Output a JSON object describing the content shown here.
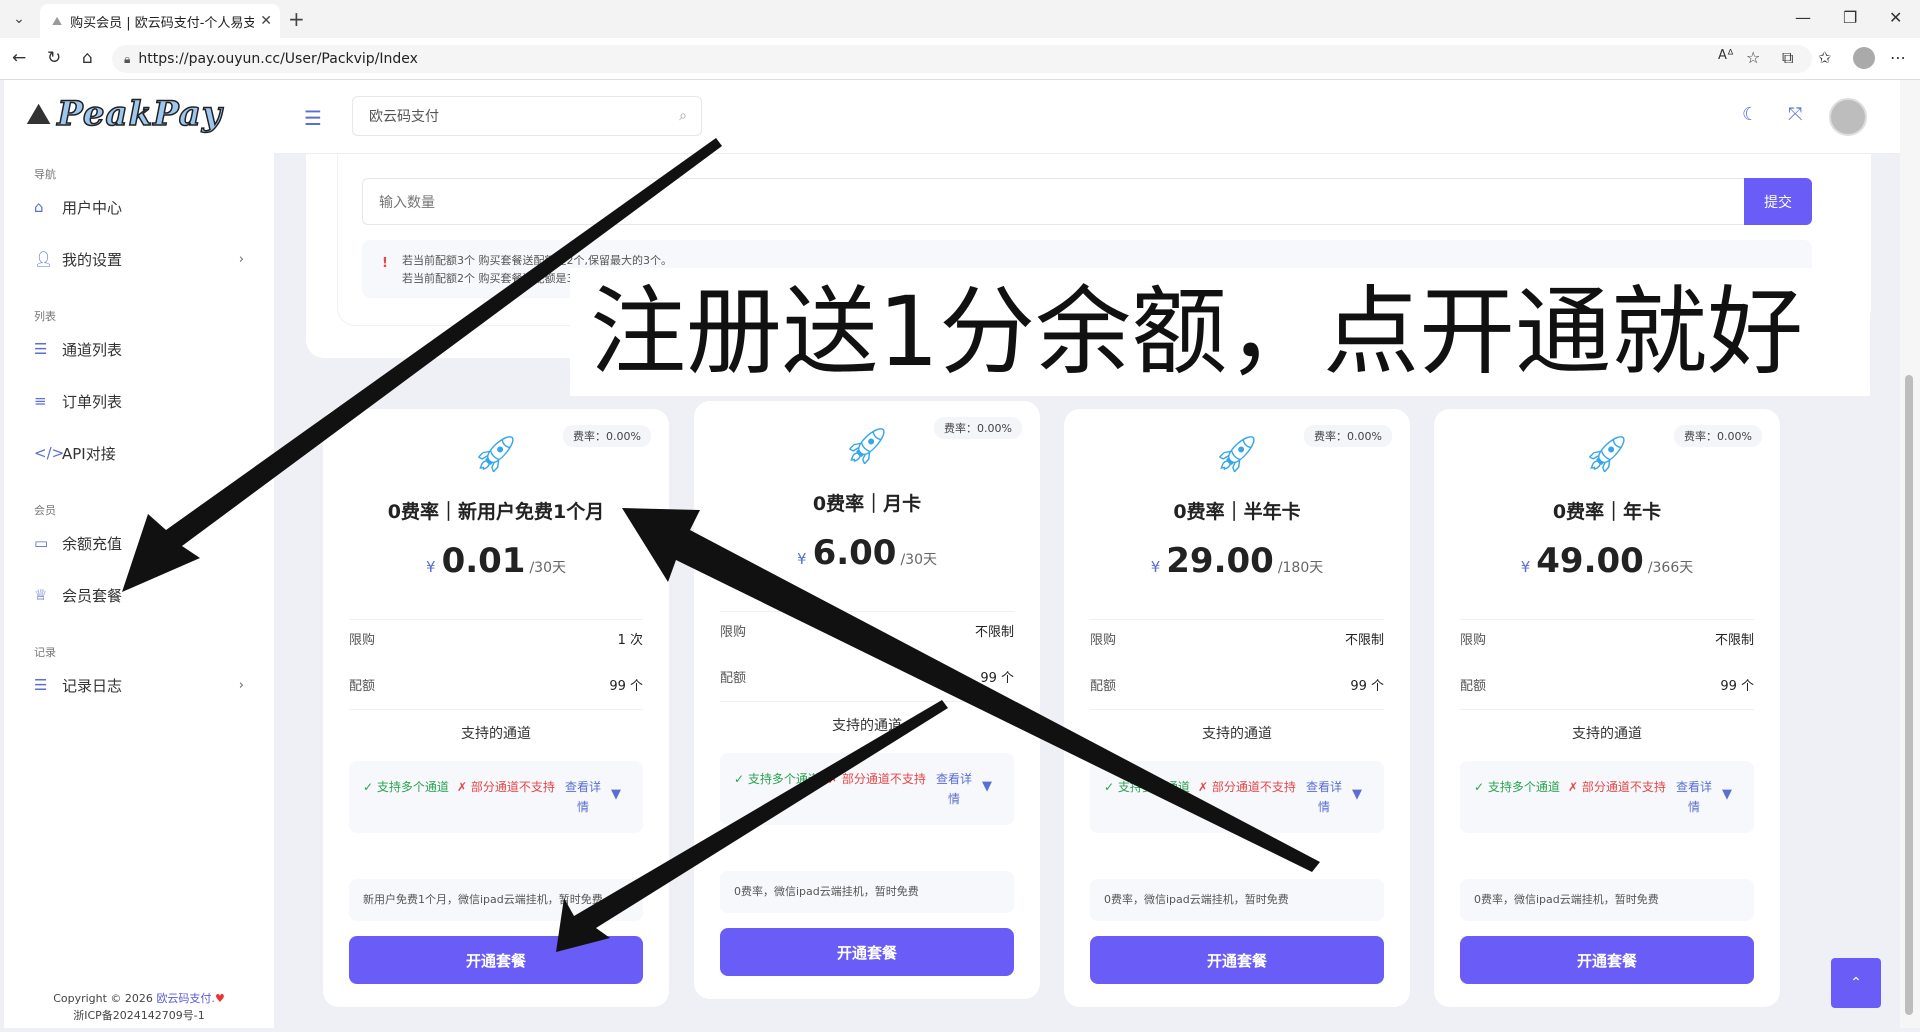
{
  "browser": {
    "tab_title": "购买会员 | 欧云码支付-个人易支付",
    "url": "https://pay.ouyun.cc/User/Packvip/Index"
  },
  "sidebar": {
    "logo_text": "PeakPay",
    "sections": {
      "nav": "导航",
      "list": "列表",
      "member": "会员",
      "record": "记录"
    },
    "items": {
      "user_center": "用户中心",
      "my_settings": "我的设置",
      "channel_list": "通道列表",
      "order_list": "订单列表",
      "api": "API对接",
      "recharge": "余额充值",
      "packages": "会员套餐",
      "logs": "记录日志"
    },
    "copyright_prefix": "Copyright © 2026",
    "copyright_link": "欧云码支付.",
    "icp": "浙ICP备2024142709号-1"
  },
  "header": {
    "search_value": "欧云码支付"
  },
  "form": {
    "qty_placeholder": "输入数量",
    "submit_label": "提交",
    "notice_line1": "若当前配额3个 购买套餐送配额是2个,保留最大的3个。",
    "notice_line2": "若当前配额2个 购买套餐送配额是3个,保留最大的3个。"
  },
  "overlay_caption": "注册送1分余额，点开通就好",
  "plans": [
    {
      "rate": "费率：0.00%",
      "name": "0费率｜新用户免费1个月",
      "currency": "¥",
      "price": "0.01",
      "duration": "/30天",
      "limit_label": "限购",
      "limit_value": "1 次",
      "quota_label": "配额",
      "quota_value": "99 个",
      "channels_title": "支持的通道",
      "multi": "✓ 支持多个通道",
      "partial": "✗ 部分通道不支持",
      "details": "查看详情",
      "desc": "新用户免费1个月，微信ipad云端挂机，暂时免费",
      "button": "开通套餐"
    },
    {
      "rate": "费率：0.00%",
      "name": "0费率｜月卡",
      "currency": "¥",
      "price": "6.00",
      "duration": "/30天",
      "limit_label": "限购",
      "limit_value": "不限制",
      "quota_label": "配额",
      "quota_value": "99 个",
      "channels_title": "支持的通道",
      "multi": "✓ 支持多个通道",
      "partial": "✗ 部分通道不支持",
      "details": "查看详情",
      "desc": "0费率，微信ipad云端挂机，暂时免费",
      "button": "开通套餐"
    },
    {
      "rate": "费率：0.00%",
      "name": "0费率｜半年卡",
      "currency": "¥",
      "price": "29.00",
      "duration": "/180天",
      "limit_label": "限购",
      "limit_value": "不限制",
      "quota_label": "配额",
      "quota_value": "99 个",
      "channels_title": "支持的通道",
      "multi": "✓ 支持多个通道",
      "partial": "✗ 部分通道不支持",
      "details": "查看详情",
      "desc": "0费率，微信ipad云端挂机，暂时免费",
      "button": "开通套餐"
    },
    {
      "rate": "费率：0.00%",
      "name": "0费率｜年卡",
      "currency": "¥",
      "price": "49.00",
      "duration": "/366天",
      "limit_label": "限购",
      "limit_value": "不限制",
      "quota_label": "配额",
      "quota_value": "99 个",
      "channels_title": "支持的通道",
      "multi": "✓ 支持多个通道",
      "partial": "✗ 部分通道不支持",
      "details": "查看详情",
      "desc": "0费率，微信ipad云端挂机，暂时免费",
      "button": "开通套餐"
    }
  ],
  "colors": {
    "accent": "#6a5cf6",
    "icon": "#5a6fd1",
    "ok": "#2aa44f",
    "bad": "#e54848"
  }
}
